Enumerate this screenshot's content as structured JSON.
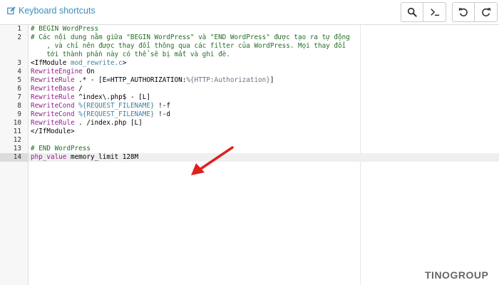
{
  "toolbar": {
    "shortcuts_label": "Keyboard shortcuts",
    "buttons": [
      {
        "icon": "search-icon"
      },
      {
        "icon": "terminal-icon"
      },
      {
        "icon": "undo-icon"
      },
      {
        "icon": "redo-icon"
      }
    ]
  },
  "editor": {
    "lines": [
      {
        "num": "1",
        "tokens": [
          {
            "t": "# BEGIN WordPress",
            "c": "cm"
          }
        ]
      },
      {
        "num": "2",
        "tokens": [
          {
            "t": "# Các nội dung nằm giữa \"BEGIN WordPress\" và \"END WordPress\" được tạo ra tự động",
            "c": "cm"
          }
        ]
      },
      {
        "num": "",
        "tokens": [
          {
            "t": "    , và chỉ nên được thay đổi thông qua các filter của WordPress. Mọi thay đổi",
            "c": "cm"
          }
        ]
      },
      {
        "num": "",
        "tokens": [
          {
            "t": "    tới thành phần này có thể sẽ bị mất và ghi đè.",
            "c": "cm"
          }
        ]
      },
      {
        "num": "3",
        "tokens": [
          {
            "t": "<IfModule ",
            "c": "tx"
          },
          {
            "t": "mod_rewrite.c",
            "c": "vr"
          },
          {
            "t": ">",
            "c": "tx"
          }
        ]
      },
      {
        "num": "4",
        "tokens": [
          {
            "t": "RewriteEngine",
            "c": "kw"
          },
          {
            "t": " On",
            "c": "tx"
          }
        ]
      },
      {
        "num": "5",
        "tokens": [
          {
            "t": "RewriteRule",
            "c": "kw"
          },
          {
            "t": " .* - [E=HTTP_AUTHORIZATION:",
            "c": "tx"
          },
          {
            "t": "%{HTTP:Authorization}",
            "c": "op"
          },
          {
            "t": "]",
            "c": "tx"
          }
        ]
      },
      {
        "num": "6",
        "tokens": [
          {
            "t": "RewriteBase",
            "c": "kw"
          },
          {
            "t": " /",
            "c": "tx"
          }
        ]
      },
      {
        "num": "7",
        "tokens": [
          {
            "t": "RewriteRule",
            "c": "kw"
          },
          {
            "t": " ^index\\.php$ - [L]",
            "c": "tx"
          }
        ]
      },
      {
        "num": "8",
        "tokens": [
          {
            "t": "RewriteCond",
            "c": "kw"
          },
          {
            "t": " %{REQUEST_FILENAME}",
            "c": "vr"
          },
          {
            "t": " !-f",
            "c": "tx"
          }
        ]
      },
      {
        "num": "9",
        "tokens": [
          {
            "t": "RewriteCond",
            "c": "kw"
          },
          {
            "t": " %{REQUEST_FILENAME}",
            "c": "vr"
          },
          {
            "t": " !-d",
            "c": "tx"
          }
        ]
      },
      {
        "num": "10",
        "tokens": [
          {
            "t": "RewriteRule",
            "c": "kw"
          },
          {
            "t": " . /index.php [L]",
            "c": "tx"
          }
        ]
      },
      {
        "num": "11",
        "tokens": [
          {
            "t": "</IfModule>",
            "c": "tx"
          }
        ]
      },
      {
        "num": "12",
        "tokens": []
      },
      {
        "num": "13",
        "tokens": [
          {
            "t": "# END WordPress",
            "c": "cm"
          }
        ]
      },
      {
        "num": "14",
        "tokens": [
          {
            "t": "php_value",
            "c": "kw"
          },
          {
            "t": " memory_limit 128M",
            "c": "tx"
          }
        ]
      }
    ]
  },
  "watermark": "TINOGROUP",
  "colors": {
    "link": "#3c8dbc",
    "arrow": "#e0201c",
    "comment": "#236e24",
    "keyword": "#91218f"
  }
}
